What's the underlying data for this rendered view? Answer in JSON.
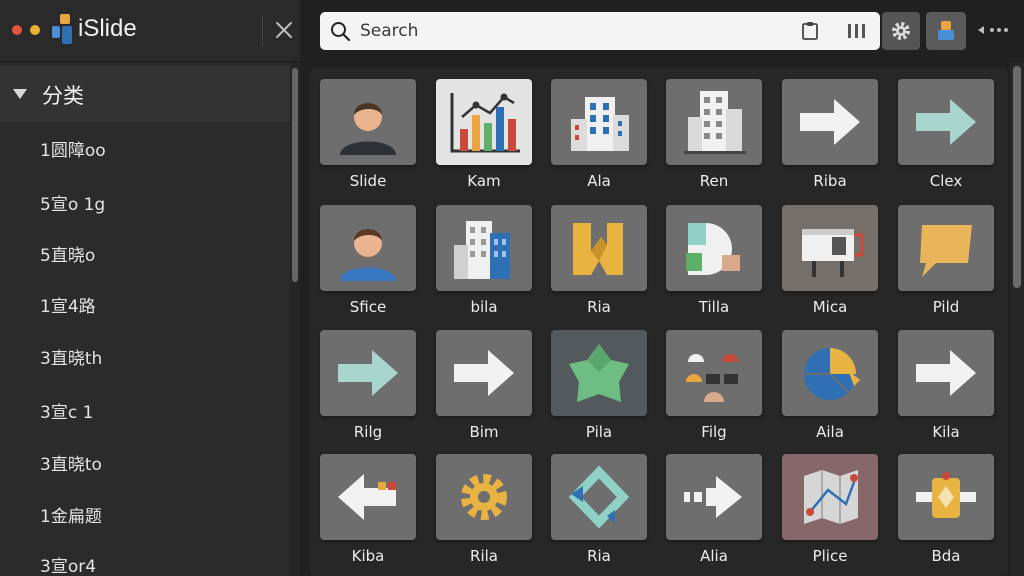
{
  "app": {
    "title": "iSlide"
  },
  "sidebar": {
    "category_header": "分类",
    "items": [
      {
        "label": "1圆障oo"
      },
      {
        "label": "5宣o 1g"
      },
      {
        "label": "5直晓o"
      },
      {
        "label": "1宣4路"
      },
      {
        "label": "3直晓th"
      },
      {
        "label": "3宣c 1"
      },
      {
        "label": "3直晓to"
      },
      {
        "label": "1金扁题"
      },
      {
        "label": "3宣or4"
      }
    ]
  },
  "search": {
    "placeholder": "Search"
  },
  "icons": {
    "close": "close-icon",
    "search": "search-icon",
    "settings": "gear-icon",
    "user": "user-icon",
    "more": "more-icon"
  },
  "colors": {
    "accent_blue": "#2f6fb3",
    "accent_orange": "#e9a640",
    "accent_green": "#5fae6a",
    "accent_red": "#c94a3b"
  },
  "grid": {
    "tiles": [
      {
        "label": "Slide",
        "icon": "person-icon"
      },
      {
        "label": "Kam",
        "icon": "bar-chart-icon"
      },
      {
        "label": "Ala",
        "icon": "building-icon"
      },
      {
        "label": "Ren",
        "icon": "office-tower-icon"
      },
      {
        "label": "Riba",
        "icon": "arrow-right-icon"
      },
      {
        "label": "Clex",
        "icon": "arrow-right-teal-icon"
      },
      {
        "label": "Sfice",
        "icon": "person-blue-icon"
      },
      {
        "label": "bila",
        "icon": "city-icon"
      },
      {
        "label": "Ria",
        "icon": "puzzle-icon"
      },
      {
        "label": "Tilla",
        "icon": "pie-blocks-icon"
      },
      {
        "label": "Mica",
        "icon": "billboard-icon"
      },
      {
        "label": "Pild",
        "icon": "speech-bubble-icon"
      },
      {
        "label": "Rilg",
        "icon": "arrow-right-teal-icon"
      },
      {
        "label": "Bim",
        "icon": "arrow-right-icon"
      },
      {
        "label": "Pila",
        "icon": "star-shape-icon"
      },
      {
        "label": "Filg",
        "icon": "people-group-icon"
      },
      {
        "label": "Aila",
        "icon": "pie-chart-icon"
      },
      {
        "label": "Kila",
        "icon": "arrow-right-icon"
      },
      {
        "label": "Kiba",
        "icon": "arrow-left-icon"
      },
      {
        "label": "Rila",
        "icon": "cog-icon"
      },
      {
        "label": "Ria",
        "icon": "cycle-icon"
      },
      {
        "label": "Alia",
        "icon": "arrow-dashed-icon"
      },
      {
        "label": "Plice",
        "icon": "map-icon"
      },
      {
        "label": "Bda",
        "icon": "badge-icon"
      }
    ]
  }
}
